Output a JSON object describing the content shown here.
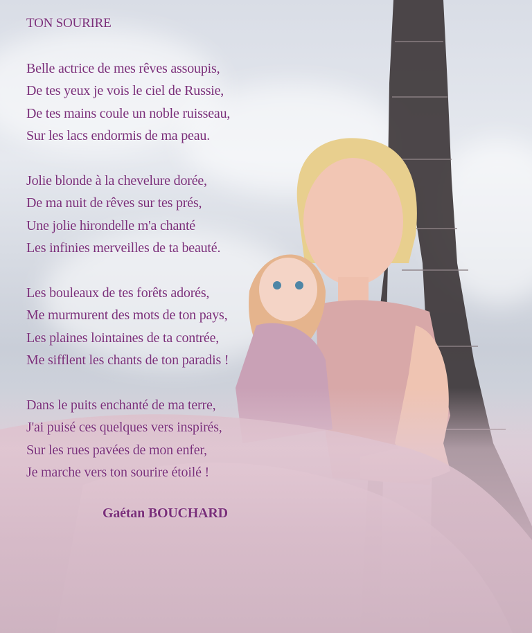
{
  "poem": {
    "title": "TON SOURIRE",
    "stanzas": [
      {
        "lines": [
          "Belle actrice de mes rêves assoupis,",
          "De tes yeux je vois le ciel de Russie,",
          "De tes mains coule un noble ruisseau,",
          "Sur les lacs endormis de ma peau."
        ]
      },
      {
        "lines": [
          "Jolie blonde à la chevelure dorée,",
          "De ma nuit de rêves sur tes prés,",
          "Une jolie hirondelle m'a chanté",
          "Les infinies merveilles de ta beauté."
        ]
      },
      {
        "lines": [
          "Les bouleaux de tes forêts adorés,",
          "Me murmurent des mots de ton pays,",
          "Les plaines lointaines de ta contrée,",
          "Me sifflent les chants de ton paradis !"
        ]
      },
      {
        "lines": [
          "Dans le puits enchanté de ma terre,",
          "J'ai puisé ces quelques vers inspirés,",
          "Sur les rues pavées de mon enfer,",
          "Je marche vers ton sourire étoilé !"
        ]
      }
    ],
    "author": "Gaétan BOUCHARD"
  },
  "colors": {
    "text": "#7a2f7a",
    "sky": "#d9dde6",
    "tower": "#3b3436",
    "dress": "#d8b3bd"
  }
}
